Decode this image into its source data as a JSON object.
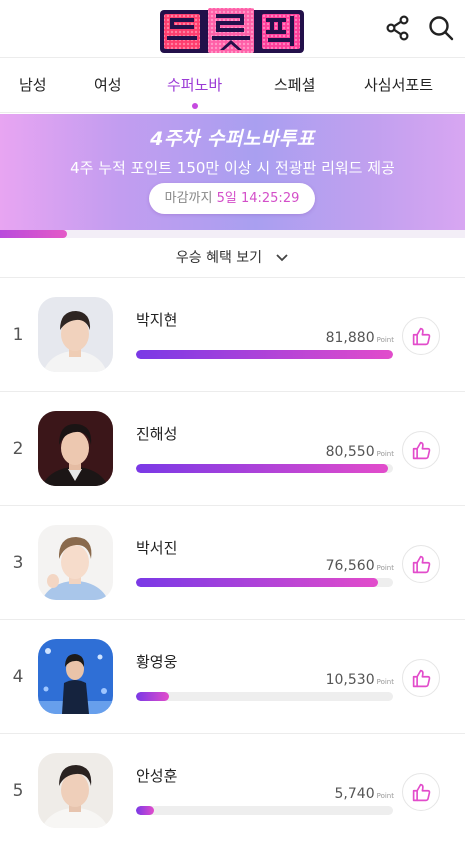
{
  "app": {
    "logo_text": "트롯픽",
    "icons": {
      "share": "share-icon",
      "search": "search-icon"
    }
  },
  "tabs": [
    {
      "label": "남성",
      "active": false
    },
    {
      "label": "여성",
      "active": false
    },
    {
      "label": "수퍼노바",
      "active": true
    },
    {
      "label": "스페셜",
      "active": false
    },
    {
      "label": "사심서포트",
      "active": false
    }
  ],
  "banner": {
    "title": "4주차 수퍼노바투표",
    "subtitle": "4주 누적 포인트 150만 이상 시 전광판 리워드 제공",
    "deadline_label": "마감까지",
    "deadline_time": "5일 14:25:29",
    "progress": 0.145
  },
  "benefit": {
    "label": "우승 혜택 보기",
    "icon": "chevron-down-icon"
  },
  "ranking": [
    {
      "rank": "1",
      "name": "박지현",
      "points": "81,880",
      "unit": "Point",
      "fill": 1.0
    },
    {
      "rank": "2",
      "name": "진해성",
      "points": "80,550",
      "unit": "Point",
      "fill": 0.98
    },
    {
      "rank": "3",
      "name": "박서진",
      "points": "76,560",
      "unit": "Point",
      "fill": 0.94
    },
    {
      "rank": "4",
      "name": "황영웅",
      "points": "10,530",
      "unit": "Point",
      "fill": 0.13
    },
    {
      "rank": "5",
      "name": "안성훈",
      "points": "5,740",
      "unit": "Point",
      "fill": 0.07
    }
  ],
  "colors": {
    "accent": "#9b3bd6",
    "bar_start": "#7a39e6",
    "bar_end": "#e24ccb",
    "like": "#e24ccb"
  }
}
